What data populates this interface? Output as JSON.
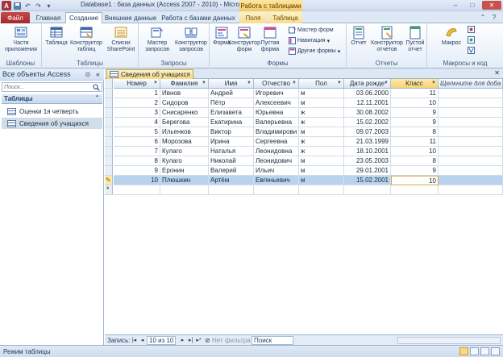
{
  "window": {
    "title": "Database1 : база данных (Access 2007 - 2010) - Microsoft Acc...",
    "context_title": "Работа с таблицами",
    "logo_letter": "A"
  },
  "ribbon_tabs": [
    {
      "label": "Файл"
    },
    {
      "label": "Главная"
    },
    {
      "label": "Создание"
    },
    {
      "label": "Внешние данные"
    },
    {
      "label": "Работа с базами данных"
    },
    {
      "label": "Поля"
    },
    {
      "label": "Таблица"
    }
  ],
  "ribbon": {
    "groups": {
      "templates": "Шаблоны",
      "tables": "Таблицы",
      "queries": "Запросы",
      "forms": "Формы",
      "reports": "Отчеты",
      "macros": "Макросы и код"
    },
    "buttons": {
      "app_parts": "Части приложения",
      "table": "Таблица",
      "table_design": "Конструктор таблиц",
      "sharepoint": "Списки SharePoint",
      "query_wizard": "Мастер запросов",
      "query_design": "Конструктор запросов",
      "form": "Форма",
      "form_design": "Конструктор форм",
      "blank_form": "Пустая форма",
      "form_wizard": "Мастер форм",
      "navigation": "Навигация",
      "more_forms": "Другие формы",
      "report": "Отчет",
      "report_design": "Конструктор отчетов",
      "blank_report": "Пустой отчет",
      "macro": "Макрос"
    }
  },
  "nav": {
    "title": "Все объекты Access",
    "search_placeholder": "Поиск...",
    "group_label": "Таблицы",
    "items": [
      {
        "label": "Оценки 1я четверть"
      },
      {
        "label": "Сведения об учащихся"
      }
    ]
  },
  "document": {
    "tab_label": "Сведения об учащихся"
  },
  "datasheet": {
    "columns": [
      "Номер",
      "Фамилия",
      "Имя",
      "Отчество",
      "Пол",
      "Дата рожде",
      "Класс",
      "Щелкните для доба"
    ],
    "rows": [
      [
        "1",
        "Ивнов",
        "Андрей",
        "Игоревич",
        "м",
        "03.06.2000",
        "11"
      ],
      [
        "2",
        "Сидоров",
        "Пётр",
        "Алексеевич",
        "м",
        "12.11.2001",
        "10"
      ],
      [
        "3",
        "Снисаренко",
        "Елизавета",
        "Юрьевна",
        "ж",
        "30.08.2002",
        "9"
      ],
      [
        "4",
        "Берегова",
        "Екатирина",
        "Валерьевна",
        "ж",
        "15.02.2002",
        "9"
      ],
      [
        "5",
        "Ильенков",
        "Виктор",
        "Владимирови",
        "м",
        "09.07.2003",
        "8"
      ],
      [
        "6",
        "Морозова",
        "Ирина",
        "Сергеевна",
        "ж",
        "21.03.1999",
        "11"
      ],
      [
        "7",
        "Кулаго",
        "Наталья",
        "Леонидовна",
        "ж",
        "18.10.2001",
        "10"
      ],
      [
        "8",
        "Кулаго",
        "Николай",
        "Леонидович",
        "м",
        "23.05.2003",
        "8"
      ],
      [
        "9",
        "Еронин",
        "Валерий",
        "Ильич",
        "м",
        "29.01.2001",
        "9"
      ],
      [
        "10",
        "Плюшкин",
        "Артём",
        "Евгеньевич",
        "м",
        "15.02.2001",
        "10"
      ]
    ],
    "new_row_marker": "*"
  },
  "record_nav": {
    "label": "Запись:",
    "position": "10 из 10",
    "filter": "Нет фильтра",
    "search": "Поиск"
  },
  "status": {
    "text": "Режим таблицы"
  }
}
